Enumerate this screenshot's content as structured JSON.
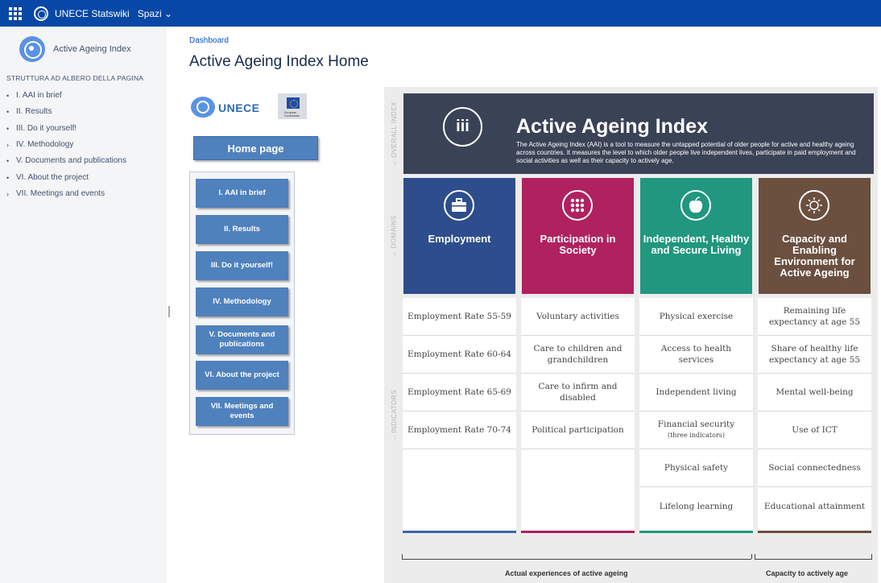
{
  "topbar": {
    "site_name": "UNECE Statswiki",
    "spaces_label": "Spazi ⌄"
  },
  "sidebar": {
    "space_name": "Active Ageing Index",
    "tree_title": "STRUTTURA AD ALBERO DELLA PAGINA",
    "items": [
      {
        "marker": "•",
        "label": "I. AAI in brief"
      },
      {
        "marker": "•",
        "label": "II. Results"
      },
      {
        "marker": "•",
        "label": "III. Do it yourself!"
      },
      {
        "marker": "›",
        "label": "IV. Methodology"
      },
      {
        "marker": "•",
        "label": "V. Documents and publications"
      },
      {
        "marker": "•",
        "label": "VI. About the project"
      },
      {
        "marker": "›",
        "label": "VII. Meetings and events"
      }
    ]
  },
  "page": {
    "breadcrumb": "Dashboard",
    "title": "Active Ageing Index Home"
  },
  "brand": {
    "unece": "UNECE",
    "eu": "European Commission"
  },
  "home_button": "Home page",
  "nav_buttons": [
    "I. AAI in brief",
    "II. Results",
    "III. Do it yourself!",
    "IV. Methodology",
    "V. Documents and publications",
    "VI. About the project",
    "VII. Meetings and events"
  ],
  "infographic": {
    "labels": {
      "overall": "→ OVERALL INDEX",
      "domains": "→ DOMAINS",
      "indicators": "→ INDICATORS"
    },
    "hero": {
      "icon": "iii",
      "title": "Active Ageing Index",
      "description": "The Active Ageing Index (AAI) is a tool to measure the untapped potential of older people for active and healthy ageing across countries. It measures the level to which older people live independent lives, participate in paid employment and social activities as well as their capacity to actively age."
    },
    "domains": [
      {
        "name": "Employment",
        "icon": "briefcase-icon",
        "color": "#2d4d8d",
        "bar": "#3a64b0",
        "indicators": [
          "Employment Rate 55-59",
          "Employment Rate 60-64",
          "Employment Rate 65-69",
          "Employment Rate 70-74"
        ]
      },
      {
        "name": "Participation in Society",
        "icon": "dots-icon",
        "color": "#b0215f",
        "bar": "#b0215f",
        "indicators": [
          "Voluntary activities",
          "Care to children and grandchildren",
          "Care to infirm and disabled",
          "Political participation"
        ]
      },
      {
        "name": "Independent, Healthy and Secure Living",
        "icon": "apple-icon",
        "color": "#20977e",
        "bar": "#20977e",
        "indicators": [
          "Physical exercise",
          "Access to health services",
          "Independent living",
          "Financial security",
          "Physical safety",
          "Lifelong learning"
        ],
        "note": "(three indicators)"
      },
      {
        "name": "Capacity and Enabling Environment for Active Ageing",
        "icon": "sun-icon",
        "color": "#6b4f3f",
        "bar": "#6b4f3f",
        "indicators": [
          "Remaining life expectancy at age 55",
          "Share of healthy life expectancy at age 55",
          "Mental well-being",
          "Use of ICT",
          "Social connectedness",
          "Educational attainment"
        ]
      }
    ],
    "bottom": {
      "left_label": "Actual experiences of active ageing",
      "right_label": "Capacity to actively age"
    }
  }
}
